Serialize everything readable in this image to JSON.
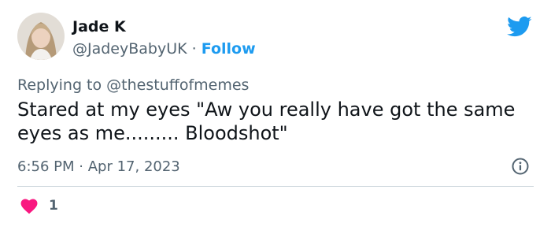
{
  "author": {
    "name": "Jade K",
    "handle": "@JadeyBabyUK",
    "separator": "·",
    "follow_label": "Follow",
    "avatar_icon": "profile-photo"
  },
  "platform_icon": "twitter-bird-icon",
  "reply": {
    "prefix": "Replying to",
    "to": "@thestuffofmemes"
  },
  "tweet": {
    "text": "Stared at my eyes \"Aw you really have got the same eyes as me......... Bloodshot\""
  },
  "meta": {
    "time": "6:56 PM",
    "separator": "·",
    "date": "Apr 17, 2023"
  },
  "actions": {
    "like_count": "1",
    "like_icon": "heart-icon",
    "info_icon": "info-icon"
  },
  "colors": {
    "accent": "#1d9bf0",
    "like": "#f91880",
    "text": "#0f1419",
    "secondary": "#536471",
    "divider": "#cfd9de"
  }
}
